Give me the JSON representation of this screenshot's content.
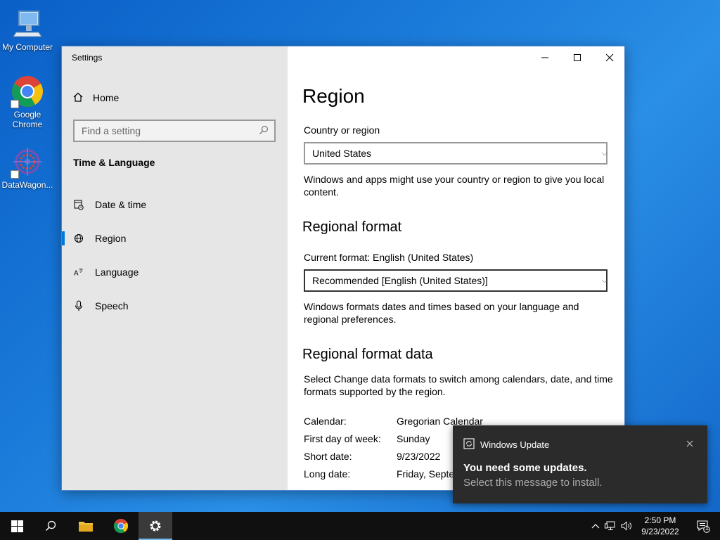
{
  "desktop": {
    "icons": [
      {
        "label": "My Computer"
      },
      {
        "label": "Google\nChrome"
      },
      {
        "label": "DataWagon..."
      }
    ]
  },
  "window": {
    "title": "Settings",
    "sidebar": {
      "home_label": "Home",
      "search_placeholder": "Find a setting",
      "section_title": "Time & Language",
      "items": [
        {
          "label": "Date & time",
          "icon": "calendar-clock-icon"
        },
        {
          "label": "Region",
          "icon": "globe-icon",
          "active": true
        },
        {
          "label": "Language",
          "icon": "language-icon"
        },
        {
          "label": "Speech",
          "icon": "microphone-icon"
        }
      ]
    },
    "main": {
      "title": "Region",
      "country_label": "Country or region",
      "country_value": "United States",
      "country_desc": "Windows and apps might use your country or region to give you local content.",
      "format_heading": "Regional format",
      "current_format": "Current format: English (United States)",
      "format_value": "Recommended [English (United States)]",
      "format_desc": "Windows formats dates and times based on your language and regional preferences.",
      "data_heading": "Regional format data",
      "data_desc": "Select Change data formats to switch among calendars, date, and time formats supported by the region.",
      "data_rows": [
        {
          "key": "Calendar:",
          "value": "Gregorian Calendar"
        },
        {
          "key": "First day of week:",
          "value": "Sunday"
        },
        {
          "key": "Short date:",
          "value": "9/23/2022"
        },
        {
          "key": "Long date:",
          "value": "Friday, Septe"
        }
      ]
    }
  },
  "toast": {
    "app": "Windows Update",
    "title": "You need some updates.",
    "body": "Select this message to install."
  },
  "taskbar": {
    "time": "2:50 PM",
    "date": "9/23/2022",
    "notification_count": "1"
  },
  "colors": {
    "accent": "#0078d7",
    "taskbar": "#101010",
    "sidebar": "#e6e6e6"
  }
}
